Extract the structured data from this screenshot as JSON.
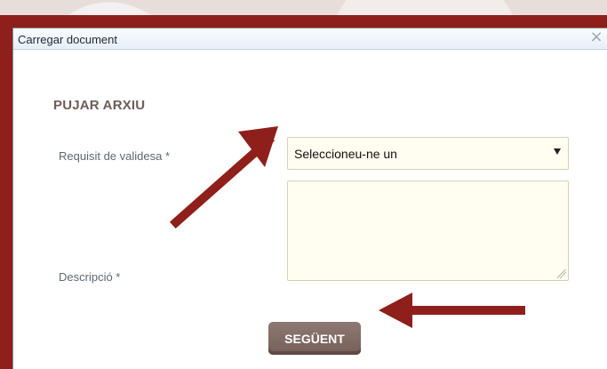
{
  "window": {
    "title": "Carregar document",
    "close_icon": "×"
  },
  "form": {
    "section_title": "PUJAR ARXIU",
    "validity_label": "Requisit de validesa *",
    "validity_selected": "Seleccioneu-ne un",
    "description_label": "Descripció *",
    "next_button": "SEGÜENT"
  },
  "colors": {
    "frame_red": "#8f1f1b",
    "button_brown": "#7f6963",
    "field_bg": "#fffef0",
    "annotation_red": "#8f1f1b"
  },
  "icons": {
    "close": "close-icon",
    "dropdown": "chevron-down-icon",
    "resize": "resize-handle-icon",
    "arrow_annotation_1": "arrow-up-right-icon",
    "arrow_annotation_2": "arrow-left-icon"
  }
}
